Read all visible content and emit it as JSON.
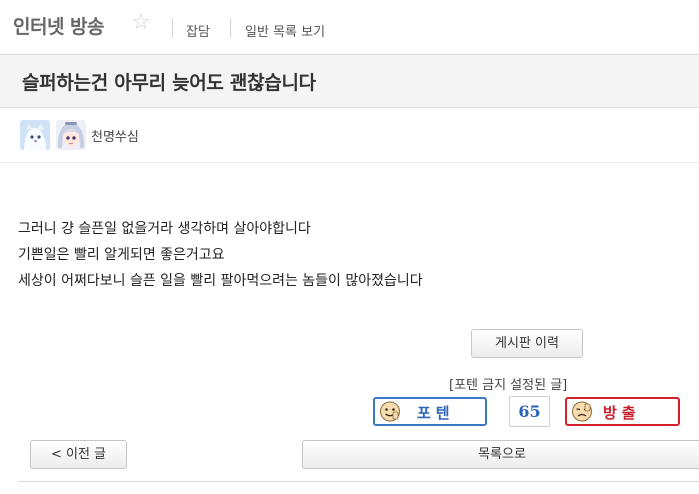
{
  "board": {
    "title": "인터넷 방송",
    "star_icon": "star-outline-icon",
    "links": [
      "잡담",
      "일반 목록 보기"
    ]
  },
  "post": {
    "title": "슬퍼하는건 아무리 늦어도 괜찮습니다",
    "author": "천명쑤심",
    "body_lines": [
      "그러니 걍 슬픈일 없을거라 생각하며 살아야합니다",
      "기쁜일은 빨리 알게되면 좋은거고요",
      "세상이 어쩌다보니 슬픈 일을 빨리 팔아먹으려는 놈들이 많아졌습니다"
    ]
  },
  "actions": {
    "history_button": "게시판 이력",
    "ban_notice": "[포텐 금지 설정된 글]",
    "upvote_label": "포텐",
    "vote_count": "65",
    "downvote_label": "방출",
    "prev_button": "< 이전 글",
    "list_button": "목록으로"
  },
  "colors": {
    "upvote": "#3a78c5",
    "downvote": "#d2202c",
    "count": "#2b63b5"
  }
}
